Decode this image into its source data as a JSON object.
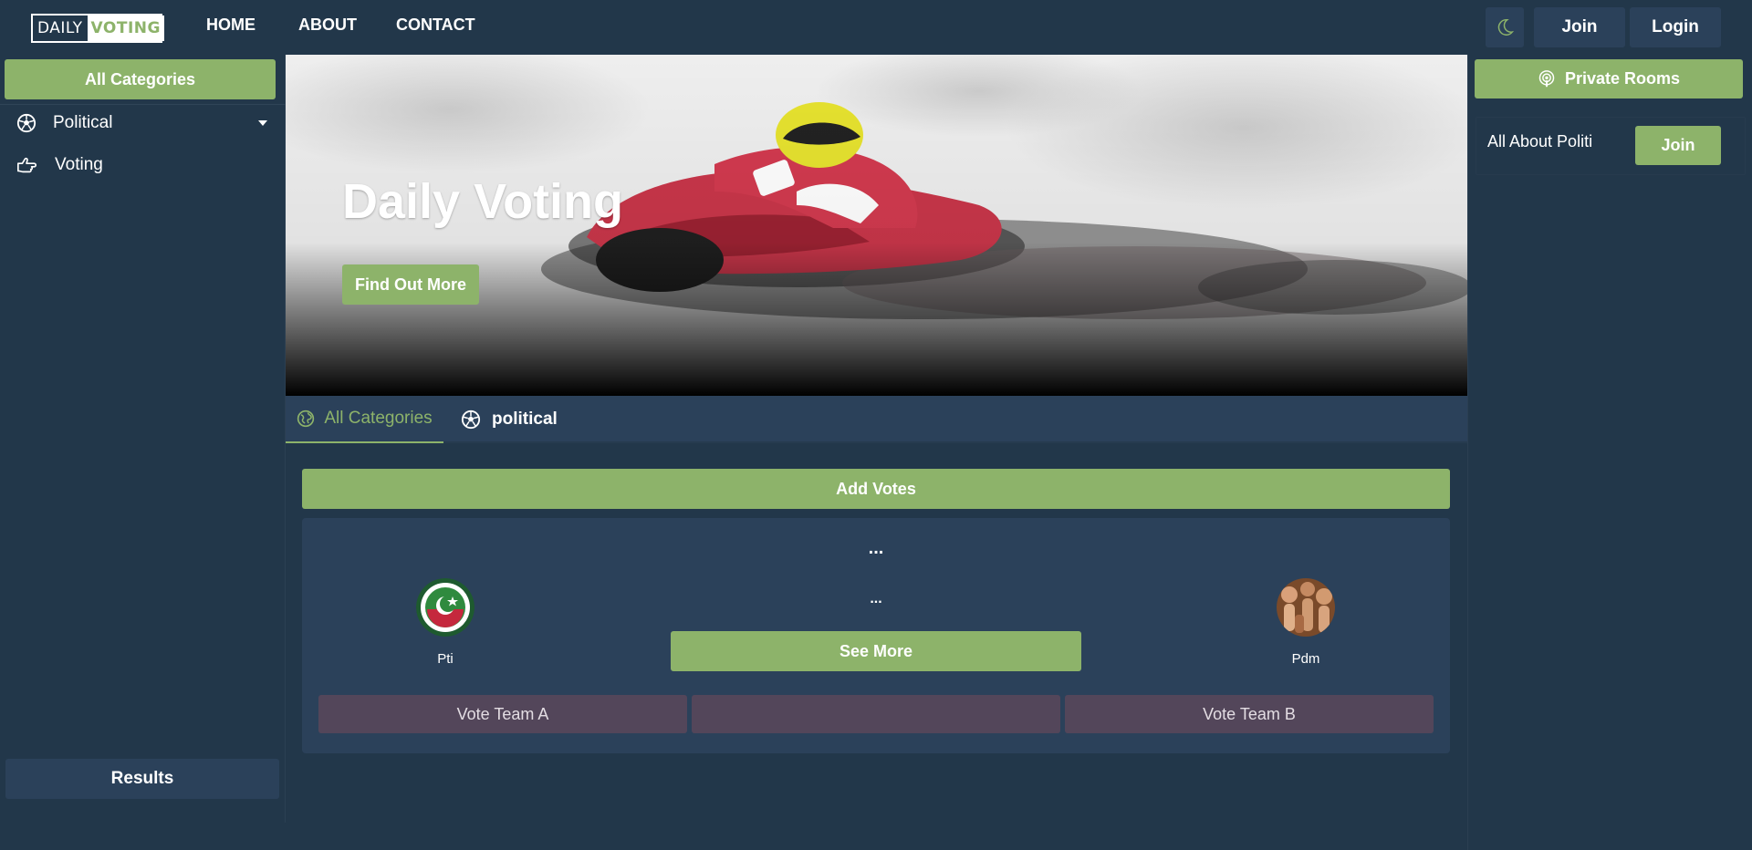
{
  "header": {
    "logo_daily": "DAILY",
    "logo_voting": "VOTING",
    "nav": [
      "HOME",
      "ABOUT",
      "CONTACT"
    ],
    "join_label": "Join",
    "login_label": "Login"
  },
  "left_sidebar": {
    "all_categories_label": "All Categories",
    "items": [
      {
        "label": "Political",
        "icon": "soccer-ball-icon"
      },
      {
        "label": "Voting",
        "icon": "hand-point-right-icon"
      }
    ],
    "results_label": "Results"
  },
  "hero": {
    "title": "Daily Voting",
    "button_label": "Find Out More"
  },
  "tabs": [
    {
      "label": "All Categories",
      "icon": "globe-icon",
      "active": true
    },
    {
      "label": "political",
      "icon": "soccer-ball-icon",
      "active": false
    }
  ],
  "main": {
    "add_votes_label": "Add Votes",
    "vote_card": {
      "title": "...",
      "subtitle": "...",
      "team_a": "Pti",
      "team_b": "Pdm",
      "see_more_label": "See More",
      "vote_a_label": "Vote Team A",
      "vote_middle_label": "",
      "vote_b_label": "Vote Team B"
    }
  },
  "right_sidebar": {
    "private_rooms_label": "Private Rooms",
    "rooms": [
      {
        "name": "All About Politi",
        "join_label": "Join"
      }
    ]
  },
  "colors": {
    "background": "#22374a",
    "panel": "#2b415a",
    "accent_green": "#8db36a",
    "vote_button": "#53465a"
  }
}
